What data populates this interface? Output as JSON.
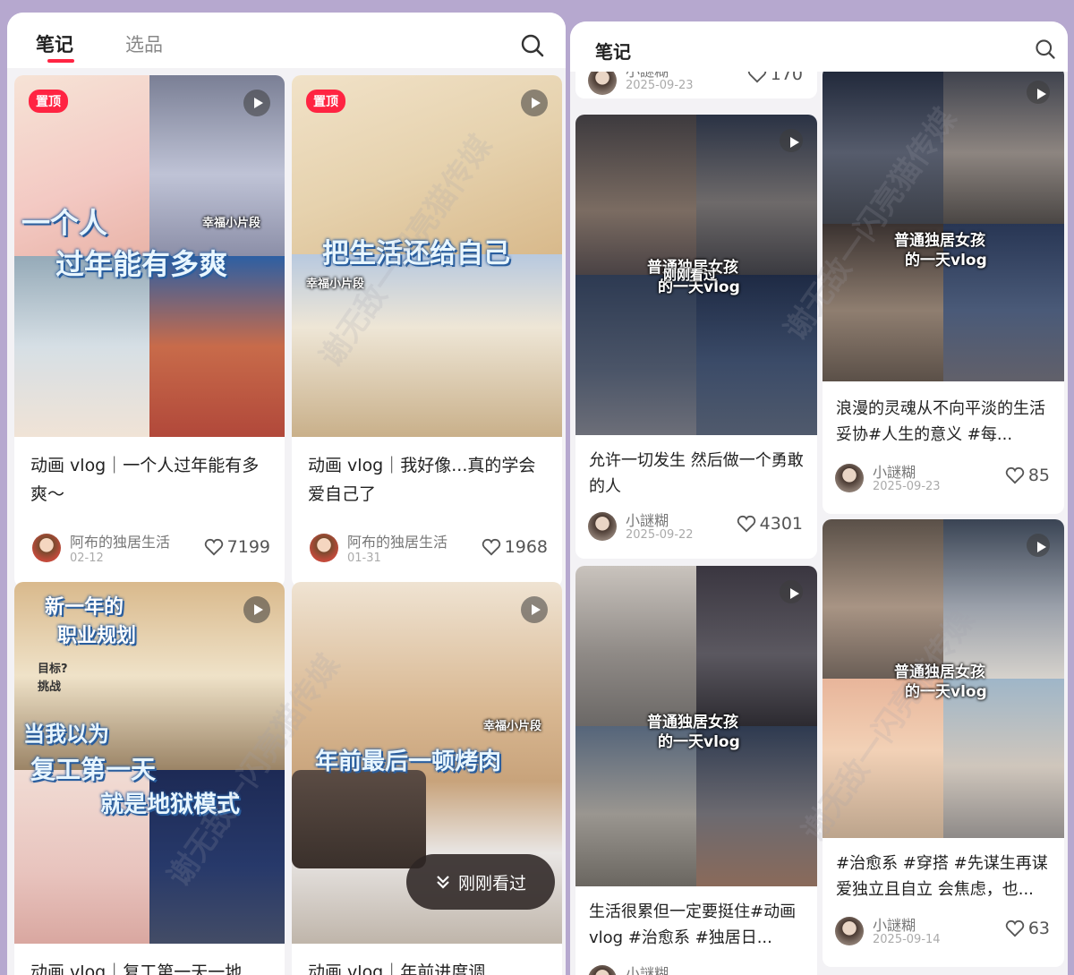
{
  "left_panel": {
    "tabs": [
      {
        "label": "笔记"
      },
      {
        "label": "选品"
      }
    ],
    "search_icon": "search-icon",
    "recently_viewed_button": "刚刚看过",
    "cards": [
      {
        "pinned": "置顶",
        "overlay_lines": [
          "一个人",
          "过年能有多爽"
        ],
        "brand_stamp": "幸福小片段",
        "title": "动画 vlog｜一个人过年能有多爽～",
        "author": "阿布的独居生活",
        "date": "02-12",
        "likes": "7199"
      },
      {
        "pinned": "置顶",
        "overlay_lines": [
          "把生活还给自己"
        ],
        "brand_stamp": "幸福小片段",
        "title": "动画 vlog｜我好像...真的学会爱自己了",
        "author": "阿布的独居生活",
        "date": "01-31",
        "likes": "1968"
      },
      {
        "overlay_lines": [
          "新一年的",
          "职业规划",
          "目标?",
          "挑战",
          "当我以为",
          "复工第一天",
          "就是地狱模式"
        ],
        "title": "动画 vlog｜复工第一天一地"
      },
      {
        "overlay_lines": [
          "年前最后一顿烤肉"
        ],
        "brand_stamp": "幸福小片段",
        "title": "动画 vlog｜年前进度调"
      }
    ]
  },
  "right_panel": {
    "tabs": [
      {
        "label": "笔记"
      }
    ],
    "search_icon": "search-icon",
    "cards": [
      {
        "author": "小謎糊",
        "date": "2025-09-23",
        "likes": "170"
      },
      {
        "overlay_lines": [
          "普通独居女孩",
          "的一天vlog"
        ],
        "overlay_label": "刚刚看过",
        "title": "允许一切发生 然后做一个勇敢的人",
        "author": "小謎糊",
        "date": "2025-09-22",
        "likes": "4301"
      },
      {
        "overlay_lines": [
          "普通独居女孩",
          "的一天vlog"
        ],
        "title": "浪漫的灵魂从不向平淡的生活妥协#人生的意义 #每...",
        "author": "小謎糊",
        "date": "2025-09-23",
        "likes": "85"
      },
      {
        "overlay_lines": [
          "普通独居女孩",
          "的一天vlog"
        ],
        "title": "生活很累但一定要挺住#动画 vlog #治愈系 #独居日...",
        "author": "小謎糊"
      },
      {
        "overlay_lines": [
          "普通独居女孩",
          "的一天vlog"
        ],
        "title": "#治愈系 #穿搭 #先谋生再谋爱独立且自立 会焦虑，也...",
        "author": "小謎糊",
        "date": "2025-09-14",
        "likes": "63"
      }
    ]
  },
  "watermark": "谢无敌一闪亮猫传媒",
  "colors": {
    "accent": "#ff2442",
    "background": "#b6a8cf",
    "card": "#ffffff",
    "overlay_text_outline": "#2a5e9e"
  },
  "icons": [
    "search-icon",
    "play-icon",
    "heart-icon",
    "chevron-down-double-icon",
    "avatar"
  ]
}
